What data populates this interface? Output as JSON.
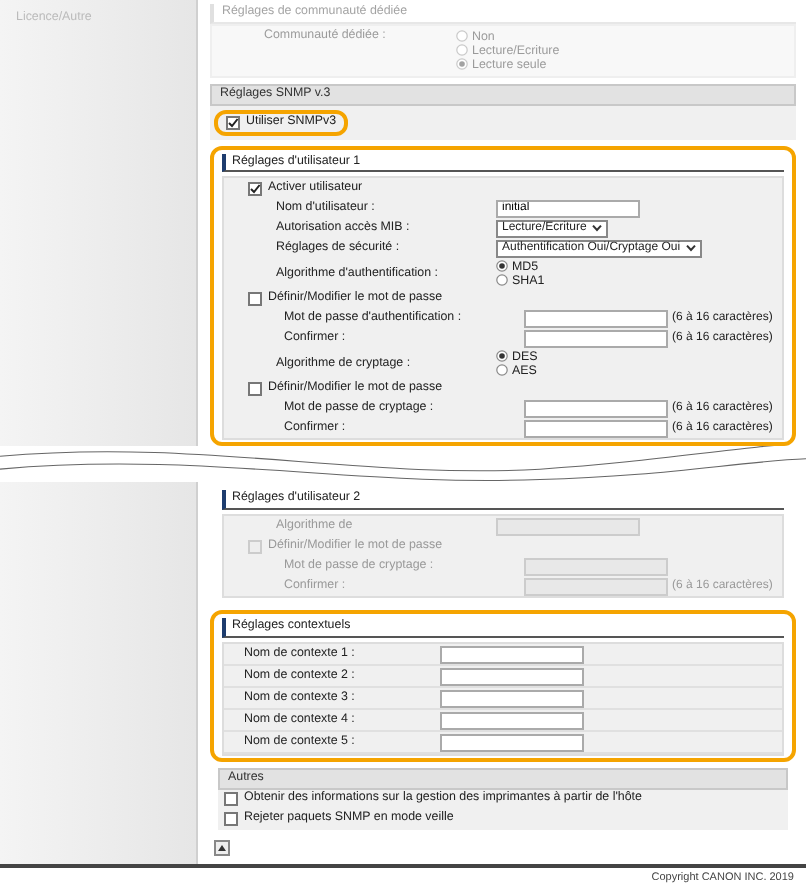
{
  "sidebar": {
    "items": [
      {
        "label": "Licence/Autre"
      }
    ]
  },
  "community": {
    "title": "Réglages de communauté dédiée",
    "label": "Communauté dédiée :",
    "options": [
      {
        "label": "Non",
        "selected": false
      },
      {
        "label": "Lecture/Ecriture",
        "selected": false
      },
      {
        "label": "Lecture seule",
        "selected": true
      }
    ]
  },
  "snmpv3": {
    "title": "Réglages SNMP v.3",
    "use": {
      "label": "Utiliser SNMPv3",
      "checked": true,
      "highlighted": true
    }
  },
  "user1": {
    "title": "Réglages d'utilisateur 1",
    "highlighted": true,
    "rows": [
      {
        "kind": "checkbox",
        "label": "Activer utilisateur",
        "checked": true,
        "disabled": false
      },
      {
        "kind": "text",
        "label": "Nom d'utilisateur :",
        "value": "initial",
        "disabled": false
      },
      {
        "kind": "select",
        "label": "Autorisation accès MIB :",
        "value": "Lecture/Ecriture",
        "disabled": false
      },
      {
        "kind": "select",
        "label": "Réglages de sécurité :",
        "value": "Authentification Oui/Cryptage Oui",
        "disabled": false
      },
      {
        "kind": "radio",
        "label": "Algorithme d'authentification :",
        "options": [
          {
            "label": "MD5",
            "selected": true
          },
          {
            "label": "SHA1",
            "selected": false
          }
        ]
      },
      {
        "kind": "checkbox",
        "label": "Définir/Modifier le mot de passe",
        "checked": false,
        "disabled": false,
        "children": [
          {
            "kind": "password",
            "label": "Mot de passe d'authentification :",
            "hint": "(6 à 16 caractères)",
            "disabled": false
          },
          {
            "kind": "password",
            "label": "Confirmer :",
            "hint": "(6 à 16 caractères)",
            "disabled": false
          }
        ]
      },
      {
        "kind": "radio",
        "label": "Algorithme de cryptage :",
        "options": [
          {
            "label": "DES",
            "selected": true
          },
          {
            "label": "AES",
            "selected": false
          }
        ]
      },
      {
        "kind": "checkbox",
        "label": "Définir/Modifier le mot de passe",
        "checked": false,
        "disabled": false,
        "children": [
          {
            "kind": "password",
            "label": "Mot de passe de cryptage :",
            "hint": "(6 à 16 caractères)",
            "disabled": false
          },
          {
            "kind": "password",
            "label": "Confirmer :",
            "hint": "(6 à 16 caractères)",
            "disabled": false
          }
        ]
      }
    ]
  },
  "user2": {
    "title": "Réglages d'utilisateur 2",
    "highlighted": false,
    "rows": [
      {
        "kind": "text",
        "label": "Algorithme de",
        "value": "",
        "disabled": true
      },
      {
        "kind": "checkbox",
        "label": "Définir/Modifier le mot de passe",
        "checked": false,
        "disabled": true,
        "children": [
          {
            "kind": "password",
            "label": "Mot de passe de cryptage :",
            "disabled": true
          },
          {
            "kind": "password",
            "label": "Confirmer :",
            "hint": "(6 à 16 caractères)",
            "disabled": true
          }
        ]
      }
    ]
  },
  "context": {
    "title": "Réglages contextuels",
    "highlighted": true,
    "fields": [
      {
        "label": "Nom de contexte 1 :"
      },
      {
        "label": "Nom de contexte 2 :"
      },
      {
        "label": "Nom de contexte 3 :"
      },
      {
        "label": "Nom de contexte 4 :"
      },
      {
        "label": "Nom de contexte 5 :"
      }
    ]
  },
  "others": {
    "title": "Autres",
    "options": [
      {
        "label": "Obtenir des informations sur la gestion des imprimantes à partir de l'hôte",
        "checked": false
      },
      {
        "label": "Rejeter paquets SNMP en mode veille",
        "checked": false
      }
    ]
  },
  "footer": {
    "copyright": "Copyright CANON INC. 2019"
  }
}
